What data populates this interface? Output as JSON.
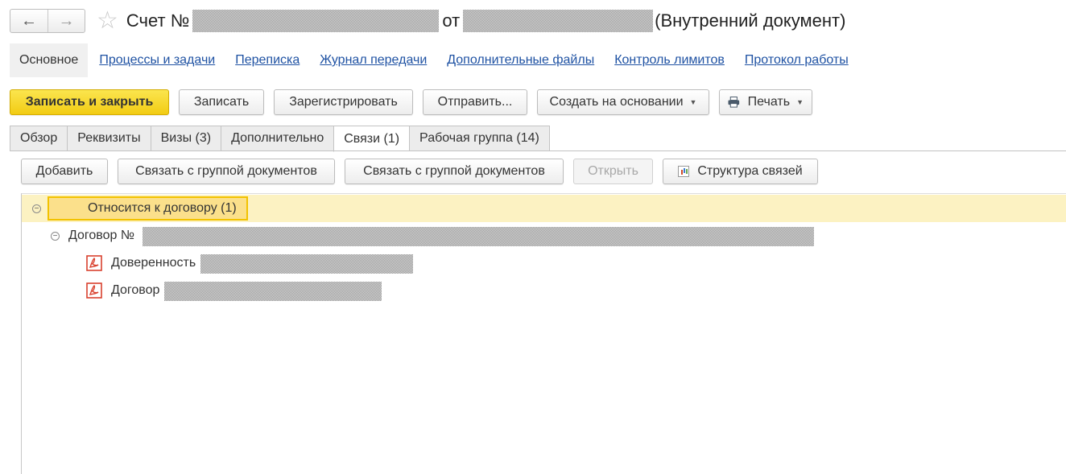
{
  "title_bar": {
    "back_icon": "arrow-left-icon",
    "forward_icon": "arrow-right-icon",
    "favorite_icon": "star-icon",
    "title_prefix": "Счет №",
    "title_middle": "от",
    "title_suffix": "(Внутренний документ)"
  },
  "sections": {
    "active": "Основное",
    "links": [
      "Процессы и задачи",
      "Переписка",
      "Журнал передачи",
      "Дополнительные файлы",
      "Контроль лимитов",
      "Протокол работы"
    ]
  },
  "toolbar": {
    "save_close": "Записать и закрыть",
    "save": "Записать",
    "register": "Зарегистрировать",
    "send": "Отправить...",
    "create_based": "Создать на основании",
    "print": "Печать",
    "print_icon": "printer-icon"
  },
  "tabs": [
    {
      "label": "Обзор",
      "active": false
    },
    {
      "label": "Реквизиты",
      "active": false
    },
    {
      "label": "Визы (3)",
      "active": false
    },
    {
      "label": "Дополнительно",
      "active": false
    },
    {
      "label": "Связи (1)",
      "active": true
    },
    {
      "label": "Рабочая группа (14)",
      "active": false
    }
  ],
  "links_toolbar": {
    "add": "Добавить",
    "link_group_1": "Связать с группой документов",
    "link_group_2": "Связать с группой документов",
    "open": "Открыть",
    "structure": "Структура связей",
    "structure_icon": "chart-icon"
  },
  "tree": {
    "group": "Относится к договору (1)",
    "contract": "Договор №",
    "files": [
      "Доверенность",
      "Договор"
    ],
    "file_icon": "pdf-icon",
    "toggle_icon": "collapse-icon"
  },
  "colors": {
    "primary_button": "#f5d020",
    "link": "#1f52a3",
    "selected_row": "#fcf2c2",
    "selected_cell_border": "#f2c200",
    "pdf_red": "#d9412e"
  }
}
